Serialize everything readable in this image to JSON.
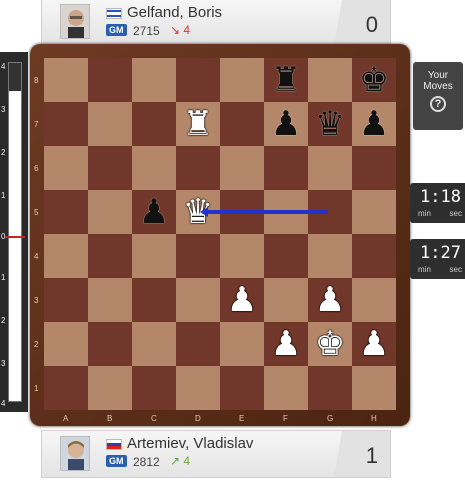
{
  "top_player": {
    "name": "Gelfand, Boris",
    "title": "GM",
    "rating": "2715",
    "rating_change": "↘ 4",
    "score": "0",
    "flag": "israel-flag-icon"
  },
  "bottom_player": {
    "name": "Artemiev, Vladislav",
    "title": "GM",
    "rating": "2812",
    "rating_change": "↗ 4",
    "score": "1",
    "flag": "russia-flag-icon"
  },
  "eval_bar": {
    "ticks": [
      "4",
      "3",
      "2",
      "1",
      "0",
      "1",
      "2",
      "3",
      "4"
    ]
  },
  "your_moves": {
    "line1": "Your",
    "line2": "Moves",
    "help": "?"
  },
  "clocks": {
    "top": {
      "time": "1:18",
      "min": "min",
      "sec": "sec"
    },
    "bottom": {
      "time": "1:27",
      "min": "min",
      "sec": "sec"
    }
  },
  "board": {
    "files": [
      "A",
      "B",
      "C",
      "D",
      "E",
      "F",
      "G",
      "H"
    ],
    "ranks": [
      "8",
      "7",
      "6",
      "5",
      "4",
      "3",
      "2",
      "1"
    ],
    "pieces": [
      {
        "square": "f8",
        "color": "b",
        "type": "rook",
        "glyph": "♜"
      },
      {
        "square": "h8",
        "color": "b",
        "type": "king",
        "glyph": "♚"
      },
      {
        "square": "d7",
        "color": "w",
        "type": "rook",
        "glyph": "♜"
      },
      {
        "square": "f7",
        "color": "b",
        "type": "pawn",
        "glyph": "♟"
      },
      {
        "square": "g7",
        "color": "b",
        "type": "queen",
        "glyph": "♛"
      },
      {
        "square": "h7",
        "color": "b",
        "type": "pawn",
        "glyph": "♟"
      },
      {
        "square": "c5",
        "color": "b",
        "type": "pawn",
        "glyph": "♟"
      },
      {
        "square": "d5",
        "color": "w",
        "type": "queen",
        "glyph": "♛"
      },
      {
        "square": "e3",
        "color": "w",
        "type": "pawn",
        "glyph": "♟"
      },
      {
        "square": "g3",
        "color": "w",
        "type": "pawn",
        "glyph": "♟"
      },
      {
        "square": "f2",
        "color": "w",
        "type": "pawn",
        "glyph": "♟"
      },
      {
        "square": "g2",
        "color": "w",
        "type": "king",
        "glyph": "♚"
      },
      {
        "square": "h2",
        "color": "w",
        "type": "pawn",
        "glyph": "♟"
      }
    ],
    "last_move_arrow": {
      "from": "g5",
      "to": "d5",
      "color": "#2233cc"
    }
  }
}
